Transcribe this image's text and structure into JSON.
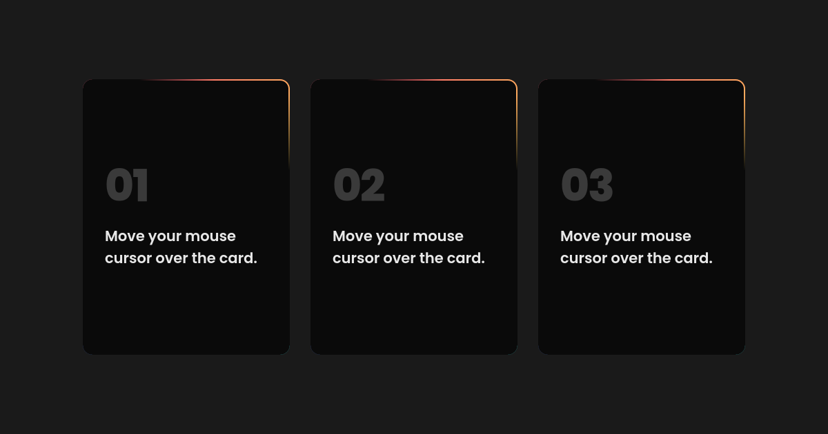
{
  "cards": [
    {
      "number": "01",
      "text": "Move your mouse cursor over the card."
    },
    {
      "number": "02",
      "text": "Move your mouse cursor over the card."
    },
    {
      "number": "03",
      "text": "Move your mouse cursor over the card."
    }
  ]
}
